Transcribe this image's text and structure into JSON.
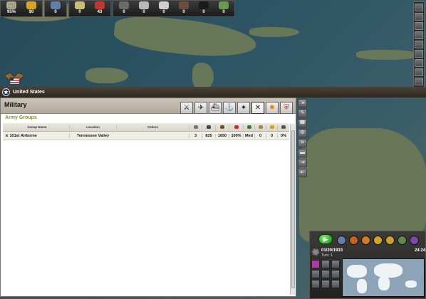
{
  "resources": [
    {
      "name": "leadership-icon",
      "value": "95%",
      "color": "#a7a38a"
    },
    {
      "name": "money-icon",
      "value": "$0",
      "color": "#d7a22e"
    },
    {
      "name": "manpower-icon",
      "value": "0",
      "color": "#5f7ea8"
    },
    {
      "name": "oil-icon",
      "value": "0",
      "color": "#c8c079"
    },
    {
      "name": "supplies-icon",
      "value": "43",
      "color": "#b83a30"
    },
    {
      "name": "tank-icon",
      "value": "0",
      "color": "#6a6a6a"
    },
    {
      "name": "industry-icon",
      "value": "0",
      "color": "#b9b9b9"
    },
    {
      "name": "shell-icon",
      "value": "0",
      "color": "#cfcfcf"
    },
    {
      "name": "metal-icon",
      "value": "0",
      "color": "#6b4f3e"
    },
    {
      "name": "fuel-drop-icon",
      "value": "0",
      "color": "#1a1a1a"
    },
    {
      "name": "rubber-icon",
      "value": "0",
      "color": "#6a9a54"
    }
  ],
  "nation": {
    "name": "United States"
  },
  "military": {
    "title": "Military",
    "section": "Army Groups",
    "columns": {
      "name": "Group Name",
      "location": "Location",
      "orders": "Orders"
    },
    "rows": [
      {
        "name": "101st Airborne",
        "location": "Tennessee Valley",
        "orders": "",
        "c1": "3",
        "c2": "825",
        "c3": "1650",
        "c4": "100%",
        "c5": "Med",
        "c6": "0",
        "c7": "0",
        "c8": "0%"
      }
    ],
    "tabs": [
      "infantry-tab-icon",
      "aircraft-tab-icon",
      "ship-tab-icon",
      "anchor-tab-icon",
      "air-force-tab-icon",
      "crossed-swords-tab-icon",
      "explosion-tab-icon",
      "shield-tab-icon"
    ],
    "side_buttons": [
      "⇲",
      "✎",
      "☎",
      "⚙",
      "✕",
      "▬",
      "⇥",
      "⇤"
    ]
  },
  "status": {
    "date": "01/20/1933",
    "turn": "Turn: 1",
    "clock": "24:24"
  }
}
